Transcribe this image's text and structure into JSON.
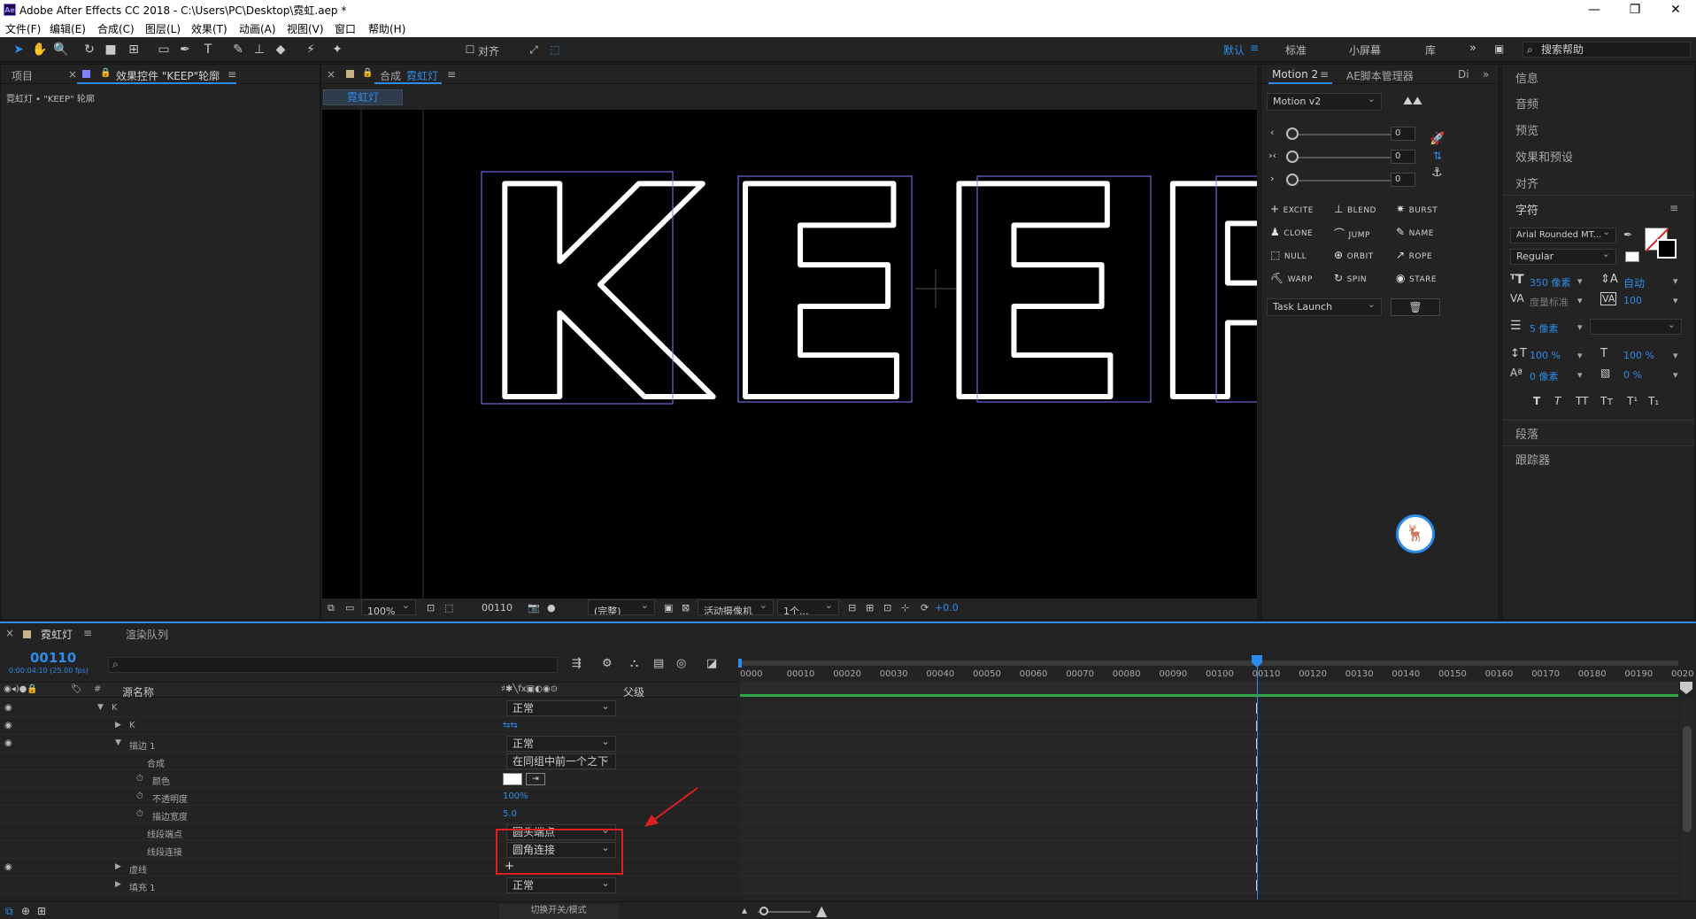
{
  "window": {
    "title": "Adobe After Effects CC 2018 - C:\\Users\\PC\\Desktop\\霓虹.aep *",
    "app_icon": "Ae",
    "controls": [
      "minimize-icon",
      "maximize-icon",
      "close-icon"
    ]
  },
  "menu": [
    "文件(F)",
    "编辑(E)",
    "合成(C)",
    "图层(L)",
    "效果(T)",
    "动画(A)",
    "视图(V)",
    "窗口",
    "帮助(H)"
  ],
  "toolbar": {
    "snap_label": "对齐",
    "workspaces": [
      "默认",
      "标准",
      "小屏幕",
      "库"
    ],
    "active_workspace": "默认",
    "search_placeholder": "搜索帮助"
  },
  "project_panel": {
    "tab_project": "项目",
    "tab_effects": "效果控件 \"KEEP\"轮廓",
    "breadcrumb": "霓虹灯 • \"KEEP\" 轮廓"
  },
  "comp_panel": {
    "tab_label": "合成",
    "comp_name": "霓虹灯",
    "subtab": "霓虹灯",
    "canvas_text": "KEEP",
    "footer": {
      "zoom": "100%",
      "timecode": "00110",
      "resolution": "(完整)",
      "camera": "活动摄像机",
      "views": "1个...",
      "exposure": "+0.0"
    }
  },
  "motion_panel": {
    "tab1": "Motion 2",
    "tab2": "AE脚本管理器",
    "tab3": "Di",
    "preset": "Motion v2",
    "sliders": [
      {
        "label": "‹",
        "value": "0"
      },
      {
        "label": "›‹",
        "value": "0"
      },
      {
        "label": "›",
        "value": "0"
      }
    ],
    "buttons": [
      [
        "EXCITE",
        "BLEND",
        "BURST"
      ],
      [
        "CLONE",
        "JUMP",
        "NAME"
      ],
      [
        "NULL",
        "ORBIT",
        "ROPE"
      ],
      [
        "WARP",
        "SPIN",
        "STARE"
      ]
    ],
    "task": "Task Launch"
  },
  "right_panels": {
    "items_top": [
      "信息",
      "音频",
      "预览",
      "效果和预设",
      "对齐"
    ],
    "character_title": "字符",
    "font_family": "Arial Rounded MT...",
    "font_style": "Regular",
    "font_size": "350 像素",
    "leading": "自动",
    "kerning": "度量标准",
    "tracking": "100",
    "stroke_width": "5 像素",
    "vscale": "100 %",
    "hscale": "100 %",
    "baseline": "0 像素",
    "tsume": "0 %",
    "style_buttons": [
      "T",
      "T",
      "TT",
      "Tт",
      "T¹",
      "T₁"
    ],
    "items_bottom": [
      "段落",
      "跟踪器"
    ]
  },
  "timeline": {
    "tab_comp": "霓虹灯",
    "tab_render": "渲染队列",
    "timecode": "00110",
    "timecode_sub": "0:00:04:10 (25.00 fps)",
    "col_name": "源名称",
    "col_parent": "父级",
    "ruler": [
      "0000",
      "00010",
      "00020",
      "00030",
      "00040",
      "00050",
      "00060",
      "00070",
      "00080",
      "00090",
      "00100",
      "00110",
      "00120",
      "00130",
      "00140",
      "00150",
      "00160",
      "00170",
      "00180",
      "00190",
      "0020"
    ],
    "rows": [
      {
        "indent": 2,
        "expander": "▼",
        "name": "K",
        "value": "正常",
        "type": "mode",
        "eye": true
      },
      {
        "indent": 3,
        "expander": "▶",
        "name": "K",
        "value": "",
        "type": "path",
        "eye": true
      },
      {
        "indent": 3,
        "expander": "▼",
        "name": "描边 1",
        "value": "正常",
        "type": "mode",
        "eye": true
      },
      {
        "indent": 4,
        "expander": "",
        "name": "合成",
        "value": "在同组中前一个之下",
        "type": "mode",
        "eye": false
      },
      {
        "indent": 4,
        "expander": "",
        "name": "颜色",
        "value": "",
        "type": "color",
        "eye": false,
        "stopwatch": true
      },
      {
        "indent": 4,
        "expander": "",
        "name": "不透明度",
        "value": "100%",
        "type": "num",
        "eye": false,
        "stopwatch": true
      },
      {
        "indent": 4,
        "expander": "",
        "name": "描边宽度",
        "value": "5.0",
        "type": "num",
        "eye": false,
        "stopwatch": true
      },
      {
        "indent": 4,
        "expander": "",
        "name": "线段端点",
        "value": "圆头端点",
        "type": "mode",
        "eye": false
      },
      {
        "indent": 4,
        "expander": "",
        "name": "线段连接",
        "value": "圆角连接",
        "type": "mode",
        "eye": false
      },
      {
        "indent": 3,
        "expander": "▶",
        "name": "虚线",
        "value": "+",
        "type": "plus",
        "eye": true
      },
      {
        "indent": 3,
        "expander": "▶",
        "name": "填充 1",
        "value": "正常",
        "type": "mode",
        "eye": false
      }
    ],
    "footer_toggle": "切换开关/模式"
  },
  "colors": {
    "accent": "#2d8ceb",
    "highlight_box": "#e02020",
    "annotation_arrow": "#e02020",
    "work_area": "#2fa64a"
  }
}
